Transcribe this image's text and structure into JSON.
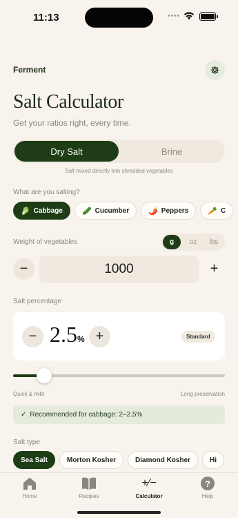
{
  "status_bar": {
    "time": "11:13"
  },
  "header": {
    "app_name": "Ferment",
    "settings_icon": "gear-icon"
  },
  "page": {
    "title": "Salt Calculator",
    "subtitle": "Get your ratios right, every time."
  },
  "mode": {
    "options": [
      "Dry Salt",
      "Brine"
    ],
    "selected": "Dry Salt",
    "help": "Salt mixed directly into shredded vegetables"
  },
  "vegetables": {
    "label": "What are you salting?",
    "items": [
      {
        "emoji": "🥬",
        "label": "Cabbage"
      },
      {
        "emoji": "🥒",
        "label": "Cucumber"
      },
      {
        "emoji": "🌶️",
        "label": "Peppers"
      },
      {
        "emoji": "🥕",
        "label": "C"
      }
    ],
    "selected": "Cabbage"
  },
  "weight": {
    "label": "Weight of vegetables",
    "units": [
      "g",
      "oz",
      "lbs"
    ],
    "selected_unit": "g",
    "value": "1000",
    "decrement": "−",
    "increment": "+"
  },
  "salt_percentage": {
    "label": "Salt percentage",
    "value": "2.5",
    "unit": "%",
    "decrement": "−",
    "increment": "+",
    "badge": "Standard",
    "slider_level": 0.145,
    "slider_min_label": "Quick & mild",
    "slider_max_label": "Long preservation"
  },
  "recommendation": {
    "check": "✓",
    "text": "Recommended for cabbage: 2–2.5%"
  },
  "salt_type": {
    "label": "Salt type",
    "items": [
      "Sea Salt",
      "Morton Kosher",
      "Diamond Kosher",
      "Hi"
    ],
    "selected": "Sea Salt"
  },
  "tabbar": {
    "items": [
      {
        "label": "Home",
        "icon": "home-icon"
      },
      {
        "label": "Recipes",
        "icon": "book-icon"
      },
      {
        "label": "Calculator",
        "icon": "calculator-icon",
        "glyph": "+∕−"
      },
      {
        "label": "Help",
        "icon": "help-icon",
        "glyph": "?"
      }
    ],
    "selected": "Calculator"
  },
  "colors": {
    "accent": "#1e3d16",
    "background": "#f8f3ec",
    "recommend_bg": "#e4ebdd"
  }
}
